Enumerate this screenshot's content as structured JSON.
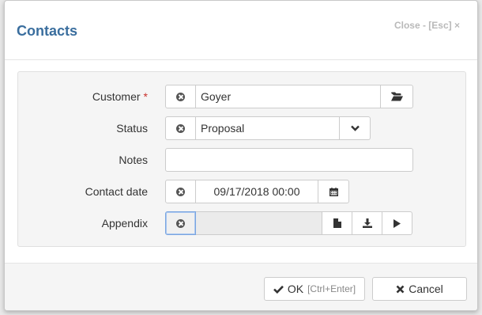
{
  "dialog": {
    "title": "Contacts",
    "close_label": "Close - [Esc] ×"
  },
  "form": {
    "customer": {
      "label": "Customer",
      "required_mark": "*",
      "value": "Goyer"
    },
    "status": {
      "label": "Status",
      "value": "Proposal"
    },
    "notes": {
      "label": "Notes",
      "value": ""
    },
    "contact_date": {
      "label": "Contact date",
      "value": "09/17/2018 00:00"
    },
    "appendix": {
      "label": "Appendix",
      "value": ""
    }
  },
  "footer": {
    "ok_label": "OK",
    "ok_hint": "[Ctrl+Enter]",
    "cancel_label": "Cancel"
  },
  "colors": {
    "title": "#3a6e9e",
    "required": "#c9302c",
    "panel_background": "#f5f5f5"
  },
  "icons": {
    "clear": "times-circle-icon",
    "browse": "folder-open-icon",
    "dropdown": "chevron-down-icon",
    "calendar": "calendar-icon",
    "file": "file-icon",
    "download": "download-icon",
    "play": "play-icon",
    "ok": "check-icon",
    "cancel": "times-icon"
  }
}
